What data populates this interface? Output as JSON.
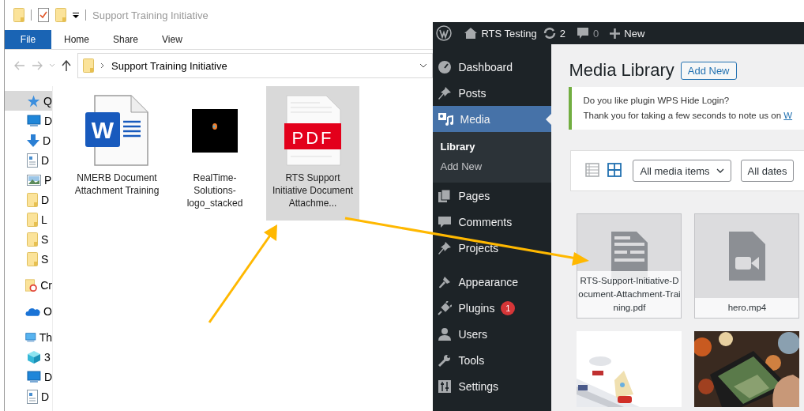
{
  "explorer": {
    "title": "Support Training Initiative",
    "file_menu": "File",
    "ribbon_tabs": [
      "Home",
      "Share",
      "View"
    ],
    "address_path": "Support Training Initiative",
    "nav_items": [
      {
        "label": "Q",
        "kind": "star",
        "selected": true
      },
      {
        "label": "D",
        "kind": "desktop",
        "selected": false
      },
      {
        "label": "D",
        "kind": "download",
        "selected": false
      },
      {
        "label": "D",
        "kind": "document",
        "selected": false
      },
      {
        "label": "P",
        "kind": "picture",
        "selected": false
      },
      {
        "label": "D",
        "kind": "folder",
        "selected": false
      },
      {
        "label": "L",
        "kind": "folder",
        "selected": false
      },
      {
        "label": "S",
        "kind": "folder",
        "selected": false
      },
      {
        "label": "S",
        "kind": "folder",
        "selected": false
      },
      {
        "label": "Cr",
        "kind": "cc",
        "selected": false
      },
      {
        "label": "O",
        "kind": "cloud",
        "selected": false
      },
      {
        "label": "Th",
        "kind": "pc",
        "selected": false
      },
      {
        "label": "3",
        "kind": "cube",
        "selected": false
      },
      {
        "label": "D",
        "kind": "desktop",
        "selected": false
      },
      {
        "label": "D",
        "kind": "document",
        "selected": false
      }
    ],
    "files": [
      {
        "name": "NMERB Document Attachment Training",
        "kind": "word",
        "icon_label": "W",
        "selected": false
      },
      {
        "name": "RealTime-Solutions-logo_stacked",
        "selected": false
      },
      {
        "name": "RTS Support Initiative Document Attachme...",
        "kind": "pdf",
        "icon_label": "PDF",
        "selected": true
      }
    ]
  },
  "wordpress": {
    "admin_bar": {
      "site": "RTS Testing",
      "updates": "2",
      "comments": "0",
      "new": "New"
    },
    "sidebar": [
      {
        "label": "Dashboard",
        "kind": "dashboard",
        "selected": false
      },
      {
        "label": "Posts",
        "kind": "pin",
        "selected": false
      },
      {
        "label": "Media",
        "kind": "media",
        "selected": true,
        "children": [
          {
            "label": "Library",
            "selected": true
          },
          {
            "label": "Add New",
            "selected": false
          }
        ]
      },
      {
        "label": "Pages",
        "kind": "pages",
        "selected": false
      },
      {
        "label": "Comments",
        "kind": "comment",
        "selected": false
      },
      {
        "label": "Projects",
        "kind": "pin",
        "selected": false
      },
      {
        "label": "Appearance",
        "kind": "brush",
        "selected": false
      },
      {
        "label": "Plugins",
        "kind": "plug",
        "selected": false,
        "badge": "1"
      },
      {
        "label": "Users",
        "kind": "user",
        "selected": false
      },
      {
        "label": "Tools",
        "kind": "wrench",
        "selected": false
      },
      {
        "label": "Settings",
        "kind": "settings",
        "selected": false
      }
    ],
    "page_title": "Media Library",
    "add_new_button": "Add New",
    "notice": {
      "line_1": "Do you like plugin WPS Hide Login?",
      "line_2": "Thank you for taking a few seconds to note us on ",
      "link": "W"
    },
    "view_modes": [
      {
        "kind": "list",
        "selected": false
      },
      {
        "kind": "grid",
        "selected": true
      }
    ],
    "filters": [
      "All media items",
      "All dates"
    ],
    "media": [
      {
        "kind": "document",
        "filename": "RTS-Support-Initiative-Document-Attachment-Training.pdf"
      },
      {
        "kind": "video",
        "filename": "hero.mp4"
      },
      {
        "kind": "picture"
      },
      {
        "kind": "picture"
      }
    ]
  }
}
